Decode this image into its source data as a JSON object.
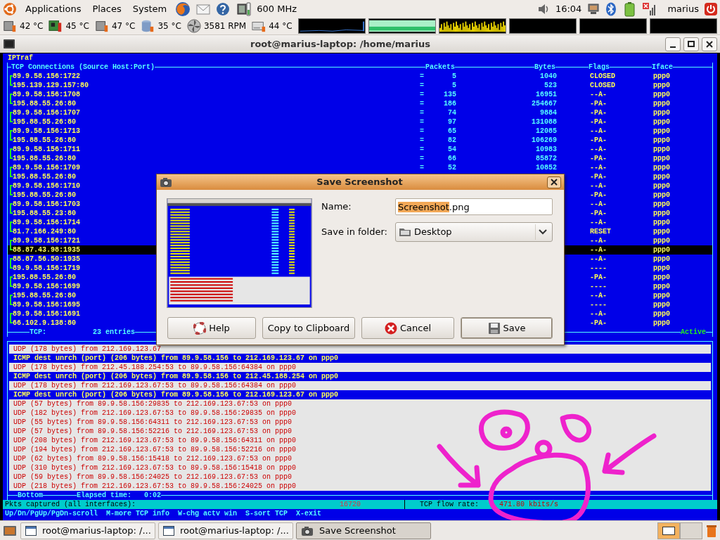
{
  "top_panel": {
    "menus": [
      "Applications",
      "Places",
      "System"
    ],
    "cpu_freq": "600 MHz",
    "clock": "16:04",
    "user": "marius"
  },
  "sensor_panel": {
    "readings": [
      {
        "kind": "chip",
        "value": "42 °C"
      },
      {
        "kind": "board",
        "value": "45 °C"
      },
      {
        "kind": "chip",
        "value": "47 °C"
      },
      {
        "kind": "disk",
        "value": "35 °C"
      },
      {
        "kind": "fan",
        "value": "3581 RPM"
      },
      {
        "kind": "drive",
        "value": "44 °C"
      }
    ],
    "monitors": [
      {
        "kind": "line"
      },
      {
        "kind": "band"
      },
      {
        "kind": "bars"
      },
      {
        "kind": "empty"
      },
      {
        "kind": "empty"
      },
      {
        "kind": "empty"
      }
    ]
  },
  "window": {
    "title": "root@marius-laptop: /home/marius"
  },
  "iptraf": {
    "title": "IPTraf",
    "tcp": {
      "heading": "TCP Connections (Source Host:Port)",
      "columns": [
        "Packets",
        "Bytes",
        "Flags",
        "Iface"
      ],
      "rows": [
        {
          "kind": "first",
          "host": "89.9.58.156:1722",
          "dir": "=",
          "packets": "5",
          "bytes": "1040",
          "flags": "CLOSED",
          "iface": "ppp0",
          "selected": false
        },
        {
          "kind": "second",
          "host": "195.139.129.157:80",
          "dir": "=",
          "packets": "5",
          "bytes": "523",
          "flags": "CLOSED",
          "iface": "ppp0",
          "selected": false
        },
        {
          "kind": "first",
          "host": "89.9.58.156:1708",
          "dir": "=",
          "packets": "135",
          "bytes": "16951",
          "flags": "--A-",
          "iface": "ppp0",
          "selected": false
        },
        {
          "kind": "second",
          "host": "195.88.55.26:80",
          "dir": "=",
          "packets": "186",
          "bytes": "254667",
          "flags": "-PA-",
          "iface": "ppp0",
          "selected": false
        },
        {
          "kind": "first",
          "host": "89.9.58.156:1707",
          "dir": "=",
          "packets": "74",
          "bytes": "9884",
          "flags": "-PA-",
          "iface": "ppp0",
          "selected": false
        },
        {
          "kind": "second",
          "host": "195.88.55.26:80",
          "dir": "=",
          "packets": "97",
          "bytes": "131088",
          "flags": "-PA-",
          "iface": "ppp0",
          "selected": false
        },
        {
          "kind": "first",
          "host": "89.9.58.156:1713",
          "dir": "=",
          "packets": "65",
          "bytes": "12085",
          "flags": "--A-",
          "iface": "ppp0",
          "selected": false
        },
        {
          "kind": "second",
          "host": "195.88.55.26:80",
          "dir": "=",
          "packets": "82",
          "bytes": "106269",
          "flags": "-PA-",
          "iface": "ppp0",
          "selected": false
        },
        {
          "kind": "first",
          "host": "89.9.58.156:1711",
          "dir": "=",
          "packets": "54",
          "bytes": "10983",
          "flags": "--A-",
          "iface": "ppp0",
          "selected": false
        },
        {
          "kind": "second",
          "host": "195.88.55.26:80",
          "dir": "=",
          "packets": "66",
          "bytes": "85872",
          "flags": "-PA-",
          "iface": "ppp0",
          "selected": false
        },
        {
          "kind": "first",
          "host": "89.9.58.156:1709",
          "dir": "=",
          "packets": "52",
          "bytes": "10852",
          "flags": "--A-",
          "iface": "ppp0",
          "selected": false
        },
        {
          "kind": "second",
          "host": "195.88.55.26:80",
          "flags": "-PA-",
          "iface": "ppp0",
          "selected": false
        },
        {
          "kind": "first",
          "host": "89.9.58.156:1710",
          "flags": "--A-",
          "iface": "ppp0",
          "selected": false
        },
        {
          "kind": "second",
          "host": "195.88.55.26:80",
          "flags": "-PA-",
          "iface": "ppp0",
          "selected": false
        },
        {
          "kind": "first",
          "host": "89.9.58.156:1703",
          "flags": "--A-",
          "iface": "ppp0",
          "selected": false
        },
        {
          "kind": "second",
          "host": "195.88.55.23:80",
          "flags": "-PA-",
          "iface": "ppp0",
          "selected": false
        },
        {
          "kind": "first",
          "host": "89.9.58.156:1714",
          "flags": "--A-",
          "iface": "ppp0",
          "selected": false
        },
        {
          "kind": "second",
          "host": "81.7.166.249:80",
          "flags": "RESET",
          "iface": "ppp0",
          "selected": false
        },
        {
          "kind": "first",
          "host": "89.9.58.156:1721",
          "flags": "--A-",
          "iface": "ppp0",
          "selected": false
        },
        {
          "kind": "second",
          "host": "88.87.43.98:1935",
          "flags": "--A-",
          "iface": "ppp0",
          "selected": true
        },
        {
          "kind": "first",
          "host": "88.87.56.50:1935",
          "flags": "--A-",
          "iface": "ppp0",
          "selected": false
        },
        {
          "kind": "second",
          "host": "89.9.58.156:1719",
          "flags": "----",
          "iface": "ppp0",
          "selected": false
        },
        {
          "kind": "first",
          "host": "195.88.55.26:80",
          "flags": "-PA-",
          "iface": "ppp0",
          "selected": false
        },
        {
          "kind": "second",
          "host": "89.9.58.156:1699",
          "flags": "----",
          "iface": "ppp0",
          "selected": false
        },
        {
          "kind": "first",
          "host": "195.88.55.26:80",
          "flags": "--A-",
          "iface": "ppp0",
          "selected": false
        },
        {
          "kind": "second",
          "host": "89.9.58.156:1695",
          "flags": "----",
          "iface": "ppp0",
          "selected": false
        },
        {
          "kind": "first",
          "host": "89.9.58.156:1691",
          "flags": "--A-",
          "iface": "ppp0",
          "selected": false
        },
        {
          "kind": "second",
          "host": "66.102.9.138:80",
          "flags": "-PA-",
          "iface": "ppp0",
          "selected": false
        }
      ],
      "footer_label": "TCP:",
      "footer_count": "23 entries",
      "status": "Active"
    },
    "log": {
      "lines": [
        {
          "kind": "udp",
          "text": "UDP (178 bytes) from 212.169.123.67"
        },
        {
          "kind": "icmp",
          "text": "ICMP dest unrch (port) (206 bytes) from 89.9.58.156 to 212.169.123.67 on ppp0"
        },
        {
          "kind": "udp",
          "text": "UDP (178 bytes) from 212.45.188.254:53 to 89.9.58.156:64384 on ppp0"
        },
        {
          "kind": "icmp",
          "text": "ICMP dest unrch (port) (206 bytes) from 89.9.58.156 to 212.45.188.254 on ppp0"
        },
        {
          "kind": "udp",
          "text": "UDP (178 bytes) from 212.169.123.67:53 to 89.9.58.156:64384 on ppp0"
        },
        {
          "kind": "icmp",
          "text": "ICMP dest unrch (port) (206 bytes) from 89.9.58.156 to 212.169.123.67 on ppp0"
        },
        {
          "kind": "udp",
          "text": "UDP (57 bytes) from 89.9.58.156:29835 to 212.169.123.67:53 on ppp0"
        },
        {
          "kind": "udp",
          "text": "UDP (182 bytes) from 212.169.123.67:53 to 89.9.58.156:29835 on ppp0"
        },
        {
          "kind": "udp",
          "text": "UDP (55 bytes) from 89.9.58.156:64311 to 212.169.123.67:53 on ppp0"
        },
        {
          "kind": "udp",
          "text": "UDP (57 bytes) from 89.9.58.156:52216 to 212.169.123.67:53 on ppp0"
        },
        {
          "kind": "udp",
          "text": "UDP (208 bytes) from 212.169.123.67:53 to 89.9.58.156:64311 on ppp0"
        },
        {
          "kind": "udp",
          "text": "UDP (194 bytes) from 212.169.123.67:53 to 89.9.58.156:52216 on ppp0"
        },
        {
          "kind": "udp",
          "text": "UDP (62 bytes) from 89.9.58.156:15418 to 212.169.123.67:53 on ppp0"
        },
        {
          "kind": "udp",
          "text": "UDP (310 bytes) from 212.169.123.67:53 to 89.9.58.156:15418 on ppp0"
        },
        {
          "kind": "udp",
          "text": "UDP (59 bytes) from 89.9.58.156:24025 to 212.169.123.67:53 on ppp0"
        },
        {
          "kind": "udp",
          "text": "UDP (218 bytes) from 212.169.123.67:53 to 89.9.58.156:24025 on ppp0"
        }
      ],
      "footer_position": "Bottom",
      "footer_elapsed_label": "Elapsed time:",
      "footer_elapsed": "0:02"
    },
    "status": {
      "captured_label": "Pkts captured (all interfaces):",
      "captured": "16720",
      "rate_label": "TCP flow rate:",
      "rate": "471.80 kbits/s"
    },
    "help": [
      "Up/Dn/PgUp/PgDn-scroll",
      "M-more TCP info",
      "W-chg actv win",
      "S-sort TCP",
      "X-exit"
    ]
  },
  "dialog": {
    "title": "Save Screenshot",
    "name_label": "Name:",
    "name_selected": "Screenshot",
    "name_rest": ".png",
    "folder_label": "Save in folder:",
    "folder": "Desktop",
    "buttons": [
      {
        "kind": "help",
        "label": "Help"
      },
      {
        "kind": "copy",
        "label": "Copy to Clipboard"
      },
      {
        "kind": "cancel",
        "label": "Cancel"
      },
      {
        "kind": "save",
        "label": "Save"
      }
    ]
  },
  "taskbar": {
    "items": [
      {
        "kind": "terminal",
        "label": "root@marius-laptop: /...",
        "selected": false
      },
      {
        "kind": "terminal",
        "label": "root@marius-laptop: /...",
        "selected": false
      },
      {
        "kind": "camera",
        "label": "Save Screenshot",
        "selected": true
      }
    ],
    "workspaces": [
      {
        "selected": true
      },
      {
        "selected": false
      }
    ]
  }
}
